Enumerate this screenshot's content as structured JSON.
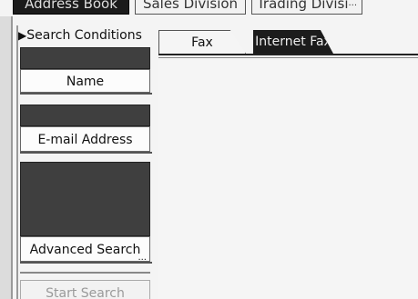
{
  "top_tabs": [
    {
      "label": "Address Book"
    },
    {
      "label": "Sales Division"
    },
    {
      "label": "Trading Divisi",
      "ellipsis": "..."
    }
  ],
  "search_conditions": {
    "title": "Search Conditions",
    "name_button": "Name",
    "email_button": "E-mail Address",
    "advanced_button": "Advanced Search",
    "advanced_ellipsis": "...",
    "start_button": "Start Search"
  },
  "content_tabs": [
    {
      "label": "Fax"
    },
    {
      "label": "Internet Fax",
      "selected": true
    }
  ],
  "colors": {
    "active_tab": "#1c1c1c",
    "dark_field": "#3f3f3f"
  },
  "icons": {
    "title_marker": "triangle-right-icon"
  }
}
